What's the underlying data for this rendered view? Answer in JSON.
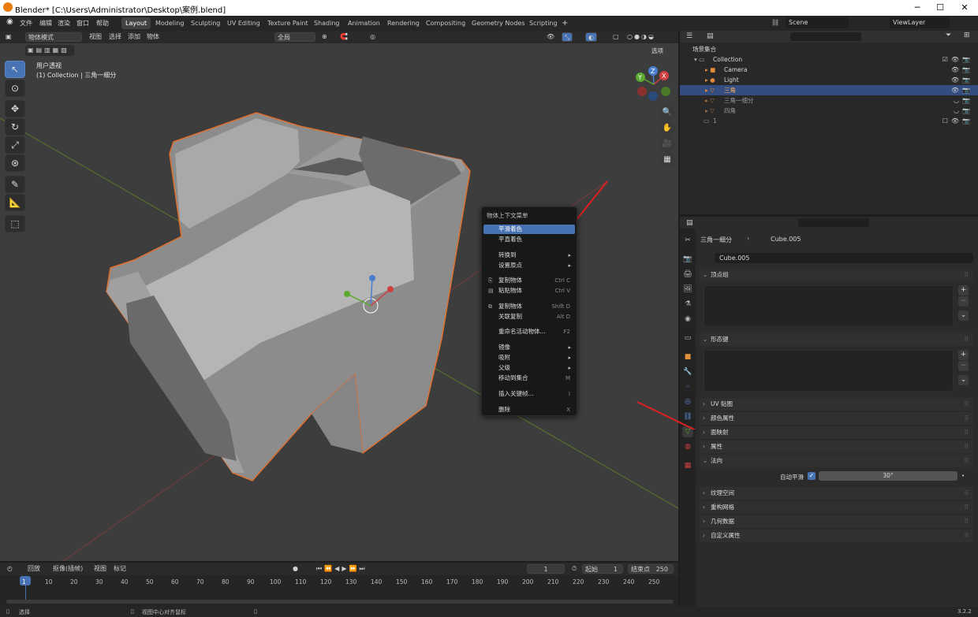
{
  "window": {
    "title": "Blender* [C:\\Users\\Administrator\\Desktop\\案例.blend]",
    "minimize": "─",
    "maximize": "☐",
    "close": "✕"
  },
  "menu": [
    "文件",
    "编辑",
    "渲染",
    "窗口",
    "帮助"
  ],
  "workspaces": [
    "Layout",
    "Modeling",
    "Sculpting",
    "UV Editing",
    "Texture Paint",
    "Shading",
    "Animation",
    "Rendering",
    "Compositing",
    "Geometry Nodes",
    "Scripting",
    "+"
  ],
  "active_workspace": "Layout",
  "scene": {
    "label": "Scene",
    "view_layer": "ViewLayer"
  },
  "viewport_header": {
    "mode": "物体模式",
    "items": [
      "视图",
      "选择",
      "添加",
      "物体"
    ],
    "orientation": "全局",
    "options": "选项"
  },
  "viewport": {
    "perspective": "用户透视",
    "collection_info": "(1) Collection | 三角一细分"
  },
  "gizmo_axes": {
    "x": "X",
    "y": "Y",
    "z": "Z"
  },
  "context_menu": {
    "title": "物体上下文菜单",
    "items": [
      {
        "label": "平滑着色",
        "shortcut": "",
        "arrow": ""
      },
      {
        "label": "平直着色",
        "shortcut": "",
        "arrow": ""
      },
      {
        "label": "转换到",
        "shortcut": "",
        "arrow": "▸"
      },
      {
        "label": "设置原点",
        "shortcut": "",
        "arrow": "▸"
      },
      {
        "label": "复制物体",
        "shortcut": "Ctrl C",
        "arrow": ""
      },
      {
        "label": "粘贴物体",
        "shortcut": "Ctrl V",
        "arrow": ""
      },
      {
        "label": "复制物体",
        "shortcut": "Shift D",
        "arrow": ""
      },
      {
        "label": "关联复制",
        "shortcut": "Alt D",
        "arrow": ""
      },
      {
        "label": "重命名活动物体...",
        "shortcut": "F2",
        "arrow": ""
      },
      {
        "label": "镜像",
        "shortcut": "",
        "arrow": "▸"
      },
      {
        "label": "吸附",
        "shortcut": "",
        "arrow": "▸"
      },
      {
        "label": "父级",
        "shortcut": "",
        "arrow": "▸"
      },
      {
        "label": "移动到集合",
        "shortcut": "M",
        "arrow": ""
      },
      {
        "label": "插入关键帧...",
        "shortcut": "I",
        "arrow": ""
      },
      {
        "label": "删除",
        "shortcut": "X",
        "arrow": ""
      }
    ]
  },
  "outliner": {
    "root": "场景集合",
    "collection": "Collection",
    "items": [
      "Camera",
      "Light",
      "三角",
      "三角一细分",
      "四角"
    ],
    "extra": "1"
  },
  "properties": {
    "breadcrumb_object": "三角一细分",
    "breadcrumb_mesh": "Cube.005",
    "mesh_name": "Cube.005",
    "sections": [
      "顶点组",
      "形态键",
      "UV 贴图",
      "颜色属性",
      "面映射",
      "属性",
      "法向",
      "纹理空间",
      "重构网格",
      "几何数据",
      "自定义属性"
    ],
    "auto_smooth_label": "自动平滑",
    "auto_smooth_checked": true,
    "auto_smooth_angle": "30°"
  },
  "timeline": {
    "menus": [
      "回放",
      "抠像(插帧)",
      "视图",
      "标记"
    ],
    "current_frame": "1",
    "start_label": "起始",
    "start": "1",
    "end_label": "结束点",
    "end": "250",
    "ticks": [
      "1",
      "10",
      "20",
      "30",
      "40",
      "50",
      "60",
      "70",
      "80",
      "90",
      "100",
      "110",
      "120",
      "130",
      "140",
      "150",
      "160",
      "170",
      "180",
      "190",
      "200",
      "210",
      "220",
      "230",
      "240",
      "250"
    ]
  },
  "statusbar": {
    "select": "选择",
    "center": "视图中心对齐鼠标",
    "version": "3.2.2"
  }
}
